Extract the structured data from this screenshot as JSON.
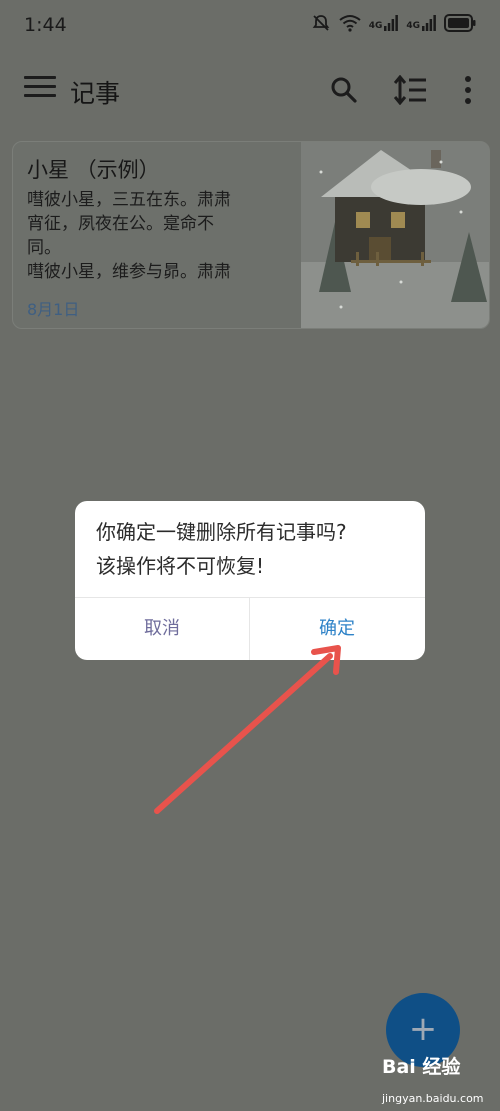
{
  "status_bar": {
    "time": "1:44",
    "signal1_label": "4G",
    "signal2_label": "4G"
  },
  "app_bar": {
    "title": "记事"
  },
  "note": {
    "title": "小星 （示例）",
    "body": "嘒彼小星，三五在东。肃肃\n宵征，夙夜在公。寔命不\n同。\n嘒彼小星，维参与昴。肃肃",
    "date": "8月1日"
  },
  "dialog": {
    "message_line1": "你确定一键删除所有记事吗?",
    "message_line2": "该操作将不可恢复!",
    "cancel_label": "取消",
    "confirm_label": "确定"
  },
  "fab": {
    "label": "+"
  },
  "watermark": {
    "brand": "Bai 经验",
    "sub": "jingyan.baidu.com"
  },
  "colors": {
    "accent": "#2f83c8",
    "fab": "#0f4f86",
    "arrow": "#e8534c",
    "overlay": "#6b6d68"
  },
  "icons": {
    "menu": "menu-icon",
    "search": "search-icon",
    "sort": "sort-icon",
    "more": "more-vert-icon",
    "mute": "bell-off-icon",
    "wifi": "wifi-icon",
    "battery": "battery-icon"
  }
}
